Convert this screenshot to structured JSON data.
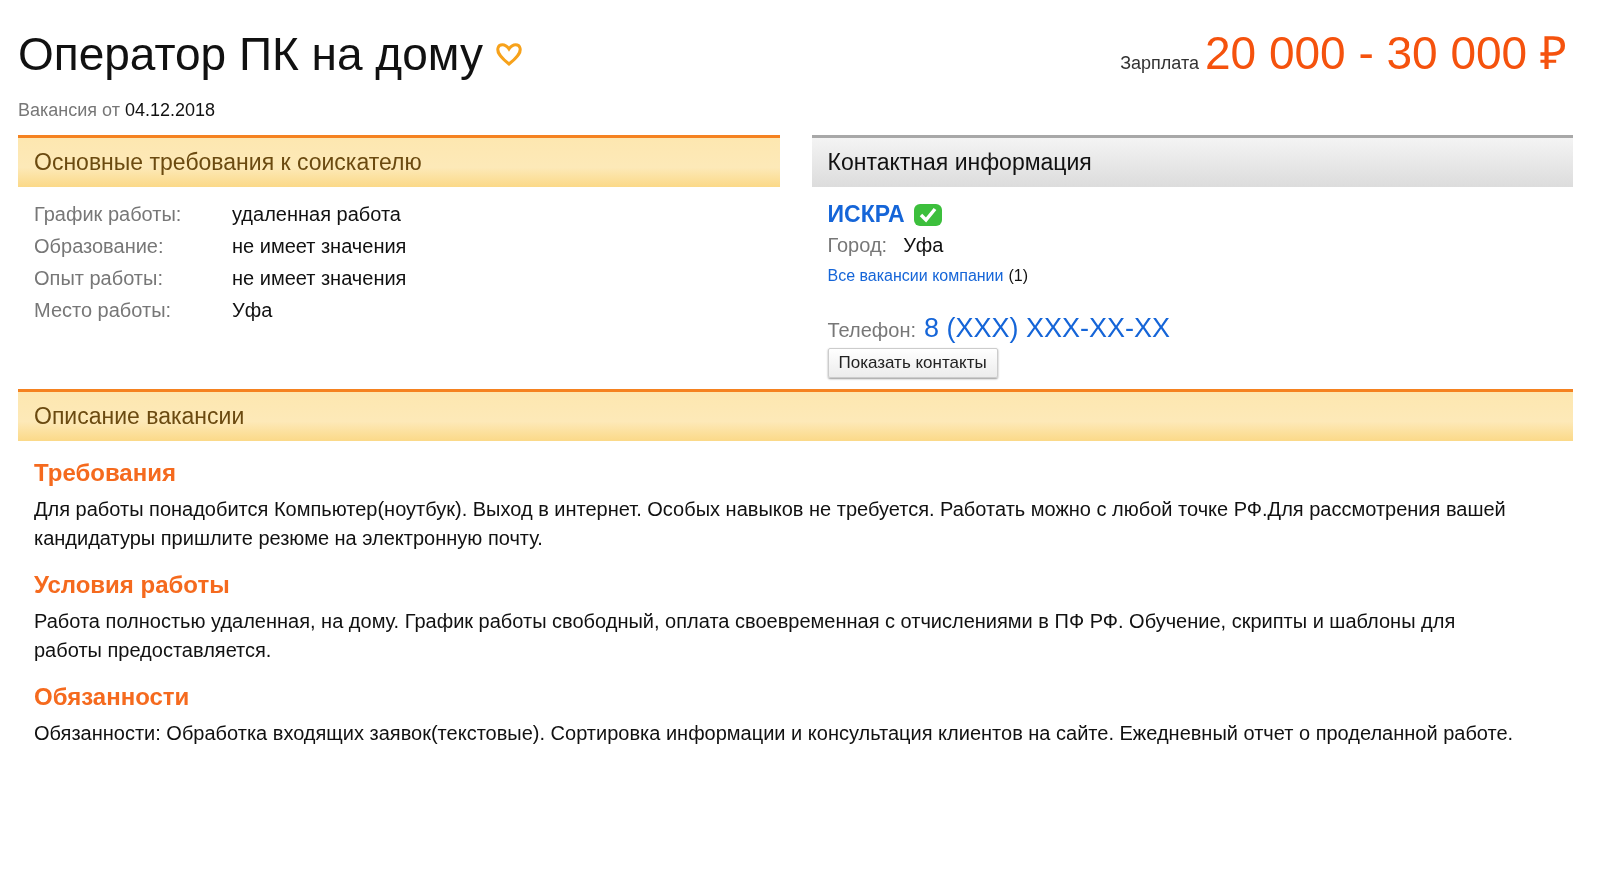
{
  "title": "Оператор ПК на дому",
  "salary": {
    "label": "Зарплата",
    "value": "20 000 - 30 000 ₽"
  },
  "posted": {
    "label": "Вакансия от",
    "date": "04.12.2018"
  },
  "requirements": {
    "heading": "Основные требования к соискателю",
    "rows": [
      {
        "label": "График работы:",
        "value": "удаленная работа"
      },
      {
        "label": "Образование:",
        "value": "не имеет значения"
      },
      {
        "label": "Опыт работы:",
        "value": "не имеет значения"
      },
      {
        "label": "Место работы:",
        "value": "Уфа"
      }
    ]
  },
  "contact": {
    "heading": "Контактная информация",
    "company": "ИСКРА",
    "verified": true,
    "city_label": "Город:",
    "city": "Уфа",
    "all_vacancies_link": "Все вакансии компании",
    "all_vacancies_count": "(1)",
    "phone_label": "Телефон:",
    "phone": "8 (XXX) XXX-XX-XX",
    "show_button": "Показать контакты"
  },
  "description": {
    "heading": "Описание вакансии",
    "sections": [
      {
        "heading": "Требования",
        "text": "Для работы понадобится Компьютер(ноутбук). Выход в интернет. Особых навыков не требуется. Работать можно с любой точке РФ.Для рассмотрения вашей кандидатуры пришлите резюме на электронную почту."
      },
      {
        "heading": "Условия работы",
        "text": "Работа полностью удаленная, на дому. График работы свободный, оплата своевременная с отчислениями в ПФ РФ. Обучение, скрипты и шаблоны для работы предоставляется."
      },
      {
        "heading": "Обязанности",
        "text": "Обязанности: Обработка входящих заявок(текстовые). Сортировка информации и консультация клиентов на сайте. Ежедневный отчет о проделанной работе."
      }
    ]
  }
}
